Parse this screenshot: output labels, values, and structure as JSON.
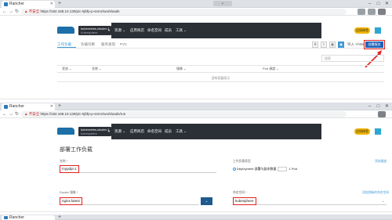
{
  "browser1": {
    "tab_title": "Rancher",
    "new_tab": "+",
    "dropdown": "⌄",
    "insecure_label": "不安全",
    "url": "https://192.168.10.130/p/c-5jhfp-p-snmz/workloads"
  },
  "header1": {
    "cluster_name": "kubernetes-cluster-1",
    "project_name": "Kubesphere",
    "nav": [
      "资源 ⌄",
      "应用商店",
      "命名空间",
      "成员",
      "工具 ⌄"
    ],
    "right_pill": "比如体验"
  },
  "workloads": {
    "tabs": [
      "工作负载",
      "负载均衡",
      "服务发现",
      "PVC"
    ],
    "import_yaml": "导入 YAML",
    "deploy_button": "部署服务",
    "search_placeholder": "搜索",
    "columns": [
      "状态 ⌄",
      "名称 ⌄",
      "镜像 ⌄",
      "Pod 调度 ⌄"
    ],
    "empty_text": "没有容器显示"
  },
  "browser2": {
    "tab_title": "Rancher",
    "new_tab": "+",
    "dropdown": "⌄",
    "insecure_label": "不安全",
    "url": "https://192.168.10.130/p/c-5jhfp-p-snmz/workloads/run"
  },
  "header2": {
    "cluster_name": "kubernetes-cluster-1",
    "project_name": "kubesphere",
    "nav": [
      "资源 ⌄",
      "应用商店",
      "命名空间",
      "成员",
      "工具 ⌄"
    ],
    "right_pill": "比如体验"
  },
  "deploy_form": {
    "title": "部署工作负载",
    "name_label": "名称 *",
    "name_value": "mypdpi-1",
    "workload_type_label": "工作负载类型",
    "workload_type_text": "Deployment 部署与副本数量",
    "pod_count": "1",
    "pod_unit": "Pod",
    "expand_link": "添加描述",
    "image_label": "Docker 镜像 *",
    "image_value": "nginx:latest",
    "namespace_label": "命名空间 *",
    "namespace_value": "kubesphere",
    "namespace_link": "添加到新的命名空间"
  },
  "browser3": {
    "tab_title": "Rancher",
    "new_tab": "+"
  }
}
